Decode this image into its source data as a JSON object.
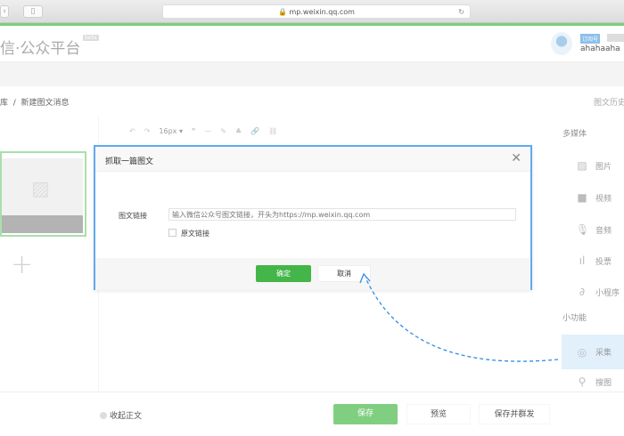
{
  "browser": {
    "url": "mp.weixin.qq.com",
    "back": "‹",
    "forward": "›",
    "reload": "↻"
  },
  "header": {
    "logo": "信·公众平台",
    "beta": "beta",
    "badge": "订阅号",
    "username": "ahahaaha"
  },
  "breadcrumb": {
    "parent": "库",
    "separator": "/",
    "current": "新建图文消息"
  },
  "history_link": "图文历史",
  "toolbar": {
    "undo": "↶",
    "redo": "↷",
    "font_size": "16px",
    "font_caret": "▾",
    "quote": "❞",
    "hr": "—",
    "eraser": "✎",
    "brush": "♣",
    "link": "🔗",
    "unlink": "⛓"
  },
  "right_panel": {
    "media_heading": "多媒体",
    "media": [
      {
        "label": "图片",
        "icon": "image-icon",
        "glyph": "▨"
      },
      {
        "label": "视频",
        "icon": "video-icon",
        "glyph": "■"
      },
      {
        "label": "音频",
        "icon": "microphone-icon",
        "glyph": "🎙"
      },
      {
        "label": "投票",
        "icon": "poll-icon",
        "glyph": "ıl"
      },
      {
        "label": "小程序",
        "icon": "mini-program-icon",
        "glyph": "∂"
      }
    ],
    "tools_heading": "小功能",
    "tools": [
      {
        "label": "采集",
        "icon": "collect-icon",
        "glyph": "◎",
        "active": true
      },
      {
        "label": "搜图",
        "icon": "search-icon",
        "glyph": "⚲"
      }
    ]
  },
  "dialog": {
    "title": "抓取一篇图文",
    "close": "✕",
    "link_label": "图文链接",
    "link_placeholder": "输入微信公众号图文链接，开头为https://mp.weixin.qq.com",
    "link_value": "",
    "checkbox_label": "原文链接",
    "checked": false,
    "ok": "确定",
    "cancel": "取消"
  },
  "footer": {
    "collapse": "收起正文",
    "save": "保存",
    "preview": "预览",
    "save_send": "保存并群发"
  },
  "colors": {
    "green": "#44b549",
    "dialog_border": "#62a9ee",
    "active_item": "#d3e8fb",
    "arrow": "#2f8be6"
  }
}
